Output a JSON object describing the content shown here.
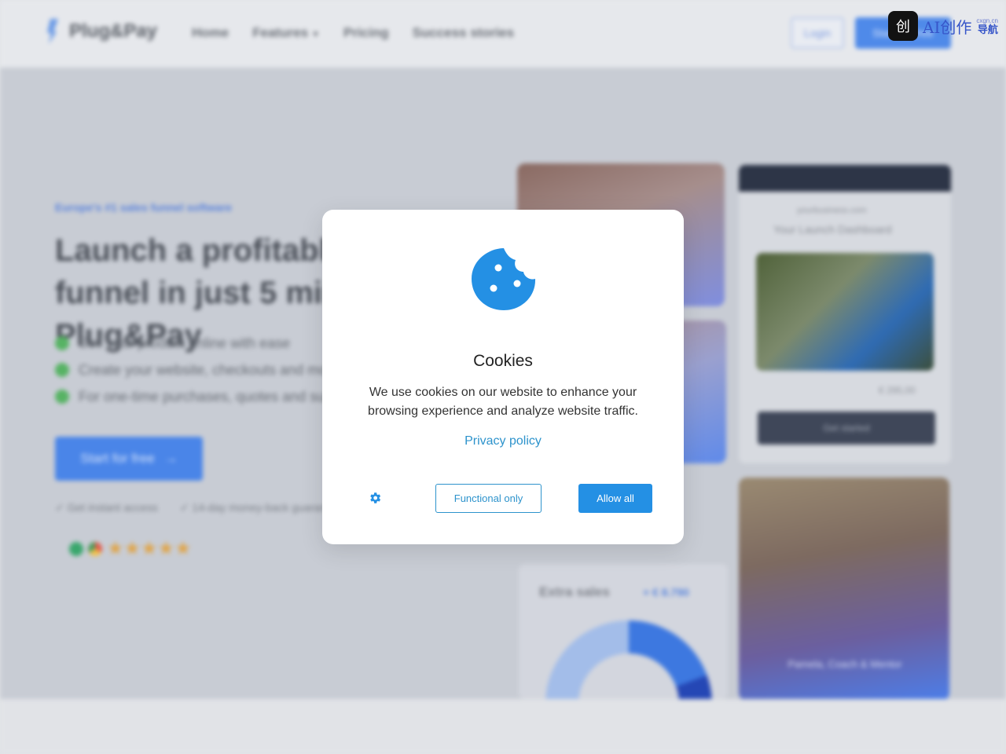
{
  "background": {
    "brand": "Plug&Pay",
    "nav": [
      "Home",
      "Features",
      "Pricing",
      "Success stories"
    ],
    "login_label": "Login",
    "start_label": "Start for free",
    "eyebrow": "Europe's #1 sales funnel software",
    "headline": "Launch a profitable sales funnel in just 5 minutes with Plug&Pay",
    "bullets": [
      "Sell your product online with ease",
      "Create your website, checkouts and more",
      "For one-time purchases, quotes and subscriptions"
    ],
    "cta_label": "Start for free",
    "checks": [
      "✓ Get instant access",
      "✓ 14-day money-back guarantee"
    ],
    "stars": "★★★★★",
    "chart_card": {
      "title": "Extra sales",
      "value": "+ € 8.790"
    },
    "browser_card": {
      "url": "yourbusiness.com",
      "tagline": "Your Launch Dashboard",
      "price": "€ 295,00",
      "button": "Get started"
    },
    "woman_caption": "Pamela, Coach & Mentor",
    "accent_color": "#4a85e8"
  },
  "watermark": {
    "icon": "创",
    "text": "AI创作",
    "sub_small": "cxgn.cn",
    "sub_big": "导航"
  },
  "modal": {
    "title": "Cookies",
    "body": "We use cookies on our website to enhance your browsing experience and analyze website traffic.",
    "privacy_link": "Privacy policy",
    "functional_label": "Functional only",
    "allow_label": "Allow all",
    "accent_color": "#2490e4",
    "icons": {
      "cookie": "cookie-icon",
      "settings": "gear-icon"
    }
  }
}
